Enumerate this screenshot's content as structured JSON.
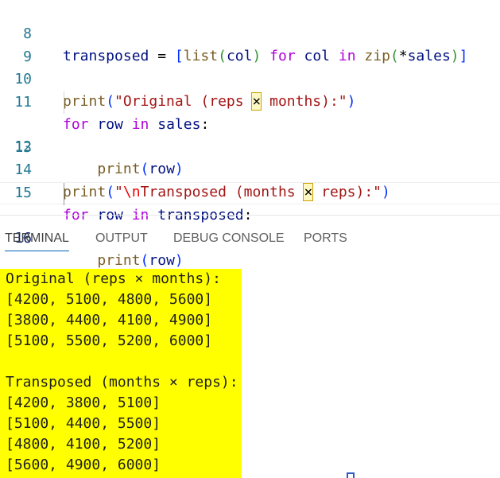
{
  "editor": {
    "lines": [
      {
        "num": "8",
        "tokens": [
          [
            "var",
            "transposed"
          ],
          [
            "op",
            " = "
          ],
          [
            "b1",
            "["
          ],
          [
            "fn",
            "list"
          ],
          [
            "b2",
            "("
          ],
          [
            "var",
            "col"
          ],
          [
            "b2",
            ")"
          ],
          [
            "op",
            " "
          ],
          [
            "kw",
            "for"
          ],
          [
            "op",
            " "
          ],
          [
            "var",
            "col"
          ],
          [
            "op",
            " "
          ],
          [
            "kw",
            "in"
          ],
          [
            "op",
            " "
          ],
          [
            "fn",
            "zip"
          ],
          [
            "b2",
            "("
          ],
          [
            "op",
            "*"
          ],
          [
            "var",
            "sales"
          ],
          [
            "b2",
            ")"
          ],
          [
            "b1",
            "]"
          ]
        ]
      },
      {
        "num": "9",
        "tokens": []
      },
      {
        "num": "10",
        "tokens": [
          [
            "fn",
            "print"
          ],
          [
            "b1",
            "("
          ],
          [
            "str",
            "\"Original (reps "
          ],
          [
            "hl",
            "×"
          ],
          [
            "str",
            " months):\""
          ],
          [
            "b1",
            ")"
          ]
        ]
      },
      {
        "num": "11",
        "tokens": [
          [
            "kw",
            "for"
          ],
          [
            "op",
            " "
          ],
          [
            "var",
            "row"
          ],
          [
            "op",
            " "
          ],
          [
            "kw",
            "in"
          ],
          [
            "op",
            " "
          ],
          [
            "var",
            "sales"
          ],
          [
            "op",
            ":"
          ]
        ]
      },
      {
        "num": "12",
        "tokens": [
          [
            "op",
            "    "
          ],
          [
            "fn",
            "print"
          ],
          [
            "b1",
            "("
          ],
          [
            "var",
            "row"
          ],
          [
            "b1",
            ")"
          ]
        ],
        "indent": true
      },
      {
        "num": "13",
        "tokens": []
      },
      {
        "num": "14",
        "tokens": [
          [
            "fn",
            "print"
          ],
          [
            "b1",
            "("
          ],
          [
            "str",
            "\""
          ],
          [
            "esc",
            "\\n"
          ],
          [
            "str",
            "Transposed (months "
          ],
          [
            "hl",
            "×"
          ],
          [
            "str",
            " reps):\""
          ],
          [
            "b1",
            ")"
          ]
        ]
      },
      {
        "num": "15",
        "tokens": [
          [
            "kw",
            "for"
          ],
          [
            "op",
            " "
          ],
          [
            "var",
            "row"
          ],
          [
            "op",
            " "
          ],
          [
            "kw",
            "in"
          ],
          [
            "op",
            " "
          ],
          [
            "var",
            "transposed"
          ],
          [
            "op",
            ":"
          ]
        ]
      },
      {
        "num": "16",
        "tokens": [
          [
            "op",
            "    "
          ],
          [
            "fn",
            "print"
          ],
          [
            "b1",
            "("
          ],
          [
            "var",
            "row"
          ],
          [
            "b1",
            ")"
          ]
        ],
        "indent": true,
        "current": true
      }
    ]
  },
  "panel": {
    "tabs": [
      "TERMINAL",
      "OUTPUT",
      "DEBUG CONSOLE",
      "PORTS"
    ],
    "active_tab": "TERMINAL"
  },
  "terminal": {
    "lines": [
      "Original (reps × months):",
      "[4200, 5100, 4800, 5600]",
      "[3800, 4400, 4100, 4900]",
      "[5100, 5500, 5200, 6000]",
      "",
      "Transposed (months × reps):",
      "[4200, 3800, 5100]",
      "[5100, 4400, 5500]",
      "[4800, 4100, 5200]",
      "[5600, 4900, 6000]"
    ],
    "highlight_color": "#ffff00"
  }
}
